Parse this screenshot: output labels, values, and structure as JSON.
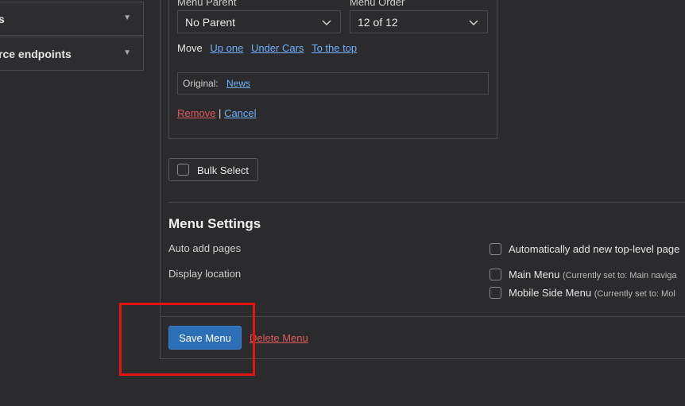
{
  "sidebar": {
    "accordions": [
      {
        "label": "s"
      },
      {
        "label": "rce endpoints"
      }
    ]
  },
  "menu_item": {
    "parent_label": "Menu Parent",
    "parent_value": "No Parent",
    "order_label": "Menu Order",
    "order_value": "12 of 12",
    "move_label": "Move",
    "move_links": [
      "Up one",
      "Under Cars",
      "To the top"
    ],
    "original_label": "Original:",
    "original_link": "News",
    "remove_label": "Remove",
    "separator": "|",
    "cancel_label": "Cancel"
  },
  "bulk_select_label": "Bulk Select",
  "settings": {
    "title": "Menu Settings",
    "auto_add_label": "Auto add pages",
    "auto_add_option": "Automatically add new top-level page",
    "display_location_label": "Display location",
    "locations": [
      {
        "name": "Main Menu",
        "note": "(Currently set to: Main naviga"
      },
      {
        "name": "Mobile Side Menu",
        "note": "(Currently set to: Mol"
      }
    ]
  },
  "footer": {
    "save_label": "Save Menu",
    "delete_label": "Delete Menu"
  },
  "colors": {
    "background": "#2b2b2d",
    "link": "#6fb0ff",
    "danger": "#e0585b",
    "primary": "#2d6fb7",
    "highlight": "#e3130f"
  }
}
